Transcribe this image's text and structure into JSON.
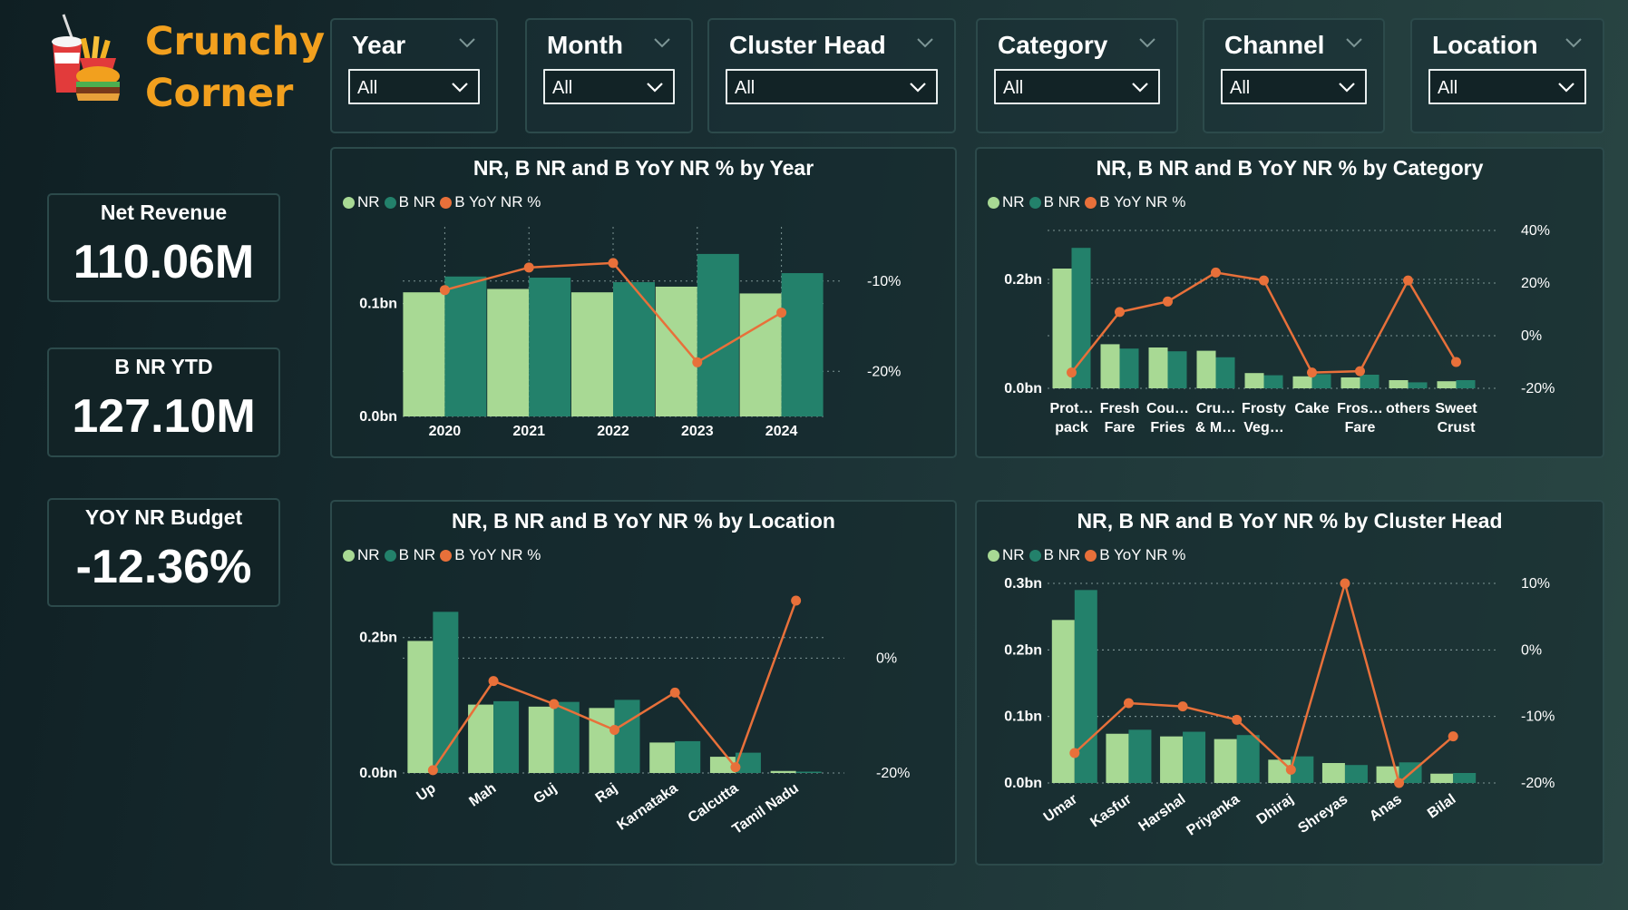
{
  "brand": {
    "line1": "Crunchy",
    "line2": "Corner"
  },
  "slicers": [
    {
      "title": "Year",
      "value": "All"
    },
    {
      "title": "Month",
      "value": "All"
    },
    {
      "title": "Cluster Head",
      "value": "All"
    },
    {
      "title": "Category",
      "value": "All"
    },
    {
      "title": "Channel",
      "value": "All"
    },
    {
      "title": "Location",
      "value": "All"
    }
  ],
  "kpis": {
    "net_revenue": {
      "label": "Net Revenue",
      "value": "110.06M"
    },
    "b_nr_ytd": {
      "label": "B NR YTD",
      "value": "127.10M"
    },
    "yoy_nr_budget": {
      "label": "YOY NR Budget",
      "value": "-12.36%"
    }
  },
  "legend": {
    "nr": "NR",
    "bnr": "B NR",
    "yoy": "B YoY NR %"
  },
  "colors": {
    "nr": "#a8d994",
    "bnr": "#23816b",
    "yoy": "#e8703a",
    "accent": "#f2a01e"
  },
  "chart_data": [
    {
      "type": "bar",
      "title": "NR, B NR and B YoY NR % by Year",
      "categories": [
        "2020",
        "2021",
        "2022",
        "2023",
        "2024"
      ],
      "series": [
        {
          "name": "NR",
          "values": [
            0.11,
            0.113,
            0.11,
            0.115,
            0.109
          ]
        },
        {
          "name": "B NR",
          "values": [
            0.124,
            0.123,
            0.119,
            0.144,
            0.127
          ]
        },
        {
          "name": "B YoY NR %",
          "axis": "right",
          "values": [
            -11,
            -8.5,
            -8,
            -19,
            -13.5
          ]
        }
      ],
      "y_ticks": [
        "0.0bn",
        "0.1bn"
      ],
      "ylim": [
        0,
        0.16
      ],
      "y2_ticks": [
        "-10%",
        "-20%"
      ],
      "y2lim": [
        -25,
        -5
      ]
    },
    {
      "type": "bar",
      "title": "NR, B NR and B YoY NR % by Category",
      "categories": [
        "Prot… pack",
        "Fresh Fare",
        "Cou… Fries",
        "Cru… & M…",
        "Frosty Veg…",
        "Cake",
        "Fros… Fare",
        "others",
        "Sweet Crust"
      ],
      "series": [
        {
          "name": "NR",
          "values": [
            0.22,
            0.081,
            0.075,
            0.069,
            0.028,
            0.022,
            0.02,
            0.015,
            0.013
          ]
        },
        {
          "name": "B NR",
          "values": [
            0.258,
            0.073,
            0.068,
            0.057,
            0.024,
            0.026,
            0.025,
            0.011,
            0.015
          ]
        },
        {
          "name": "B YoY NR %",
          "axis": "right",
          "values": [
            -14,
            9,
            13,
            24,
            21,
            -14,
            -13.5,
            21,
            -10
          ]
        }
      ],
      "y_ticks": [
        "0.0bn",
        "0.2bn"
      ],
      "ylim": [
        0,
        0.29
      ],
      "y2_ticks": [
        "-20%",
        "0%",
        "20%",
        "40%"
      ],
      "y2lim": [
        -20,
        40
      ]
    },
    {
      "type": "bar",
      "title": "NR, B NR and B YoY NR % by Location",
      "categories": [
        "Up",
        "Mah",
        "Guj",
        "Raj",
        "Karnataka",
        "Calcutta",
        "Tamil Nadu"
      ],
      "series": [
        {
          "name": "NR",
          "values": [
            0.195,
            0.101,
            0.098,
            0.096,
            0.045,
            0.024,
            0.003
          ]
        },
        {
          "name": "B NR",
          "values": [
            0.238,
            0.106,
            0.105,
            0.108,
            0.047,
            0.03,
            0.002
          ]
        },
        {
          "name": "B YoY NR %",
          "axis": "right",
          "values": [
            -19.5,
            -4,
            -8,
            -12.5,
            -6,
            -19,
            10
          ]
        }
      ],
      "y_ticks": [
        "0.0bn",
        "0.2bn"
      ],
      "ylim": [
        0,
        0.28
      ],
      "y2_ticks": [
        "-20%",
        "0%"
      ],
      "y2lim": [
        -20,
        13
      ]
    },
    {
      "type": "bar",
      "title": "NR, B NR and B YoY NR % by Cluster Head",
      "categories": [
        "Umar",
        "Kasfur",
        "Harshal",
        "Priyanka",
        "Dhiraj",
        "Shreyas",
        "Anas",
        "Bilal"
      ],
      "series": [
        {
          "name": "NR",
          "values": [
            0.245,
            0.074,
            0.07,
            0.066,
            0.035,
            0.03,
            0.025,
            0.014
          ]
        },
        {
          "name": "B NR",
          "values": [
            0.29,
            0.08,
            0.077,
            0.072,
            0.04,
            0.027,
            0.031,
            0.015
          ]
        },
        {
          "name": "B YoY NR %",
          "axis": "right",
          "values": [
            -15.5,
            -8,
            -8.5,
            -10.5,
            -18,
            10,
            -20,
            -13
          ]
        }
      ],
      "y_ticks": [
        "0.0bn",
        "0.1bn",
        "0.2bn",
        "0.3bn"
      ],
      "ylim": [
        0,
        0.3
      ],
      "y2_ticks": [
        "-20%",
        "-10%",
        "0%",
        "10%"
      ],
      "y2lim": [
        -20,
        10
      ]
    }
  ]
}
